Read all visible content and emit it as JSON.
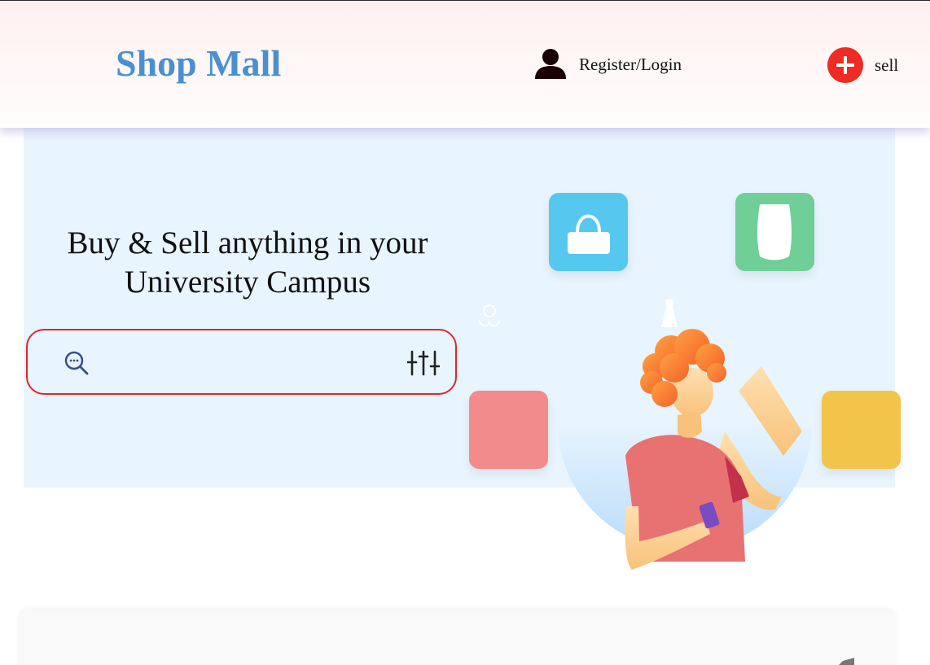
{
  "header": {
    "brand": "Shop Mall",
    "login_label": "Register/Login",
    "sell_label": "sell"
  },
  "hero": {
    "headline": "Buy & Sell anything in your University Campus",
    "search": {
      "value": "",
      "placeholder": ""
    }
  },
  "icons": {
    "user": "user-icon",
    "sell": "plus-circle-icon",
    "search": "search-icon",
    "filter": "sliders-icon"
  },
  "colors": {
    "brand": "#4a90d0",
    "sell_accent": "#ee2b24",
    "search_border": "#e0262c",
    "hero_bg": "#e8f4fe",
    "tile_blue": "#56c8f0",
    "tile_green": "#6fcf97",
    "tile_red": "#f28b8b",
    "tile_yellow": "#f2c54a"
  }
}
